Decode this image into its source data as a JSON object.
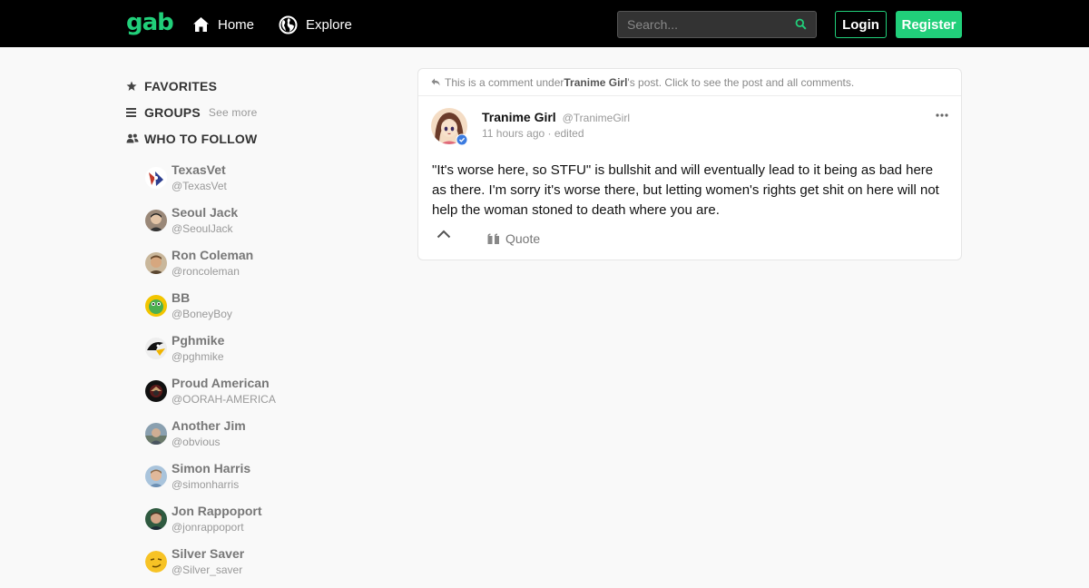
{
  "header": {
    "logo": "gab",
    "nav": {
      "home_label": "Home",
      "explore_label": "Explore"
    },
    "search": {
      "placeholder": "Search..."
    },
    "login_label": "Login",
    "register_label": "Register"
  },
  "colors": {
    "brand": "#21cf7a",
    "topbar": "#000000",
    "background": "#f9f9f9"
  },
  "sidebar": {
    "favorites_label": "FAVORITES",
    "groups_label": "GROUPS",
    "groups_see_more": "See more",
    "who_to_follow_label": "WHO TO FOLLOW",
    "follow": [
      {
        "name": "TexasVet",
        "handle": "@TexasVet"
      },
      {
        "name": "Seoul Jack",
        "handle": "@SeoulJack"
      },
      {
        "name": "Ron Coleman",
        "handle": "@roncoleman"
      },
      {
        "name": "BB",
        "handle": "@BoneyBoy"
      },
      {
        "name": "Pghmike",
        "handle": "@pghmike"
      },
      {
        "name": "Proud American",
        "handle": "@OORAH-AMERICA"
      },
      {
        "name": "Another Jim",
        "handle": "@obvious"
      },
      {
        "name": "Simon Harris",
        "handle": "@simonharris"
      },
      {
        "name": "Jon Rappoport",
        "handle": "@jonrappoport"
      },
      {
        "name": "Silver Saver",
        "handle": "@Silver_saver"
      }
    ]
  },
  "post": {
    "banner": {
      "prefix": "This is a comment under ",
      "author": "Tranime Girl",
      "suffix": "'s post. Click to see the post and all comments."
    },
    "author_name": "Tranime Girl",
    "author_handle": "@TranimeGirl",
    "meta": "11 hours ago · edited",
    "body": "\"It's worse here, so STFU\" is bullshit and will eventually lead to it being as bad here as there. I'm sorry it's worse there, but letting women's rights get shit on here will not help the woman stoned to death where you are.",
    "quote_label": "Quote"
  }
}
